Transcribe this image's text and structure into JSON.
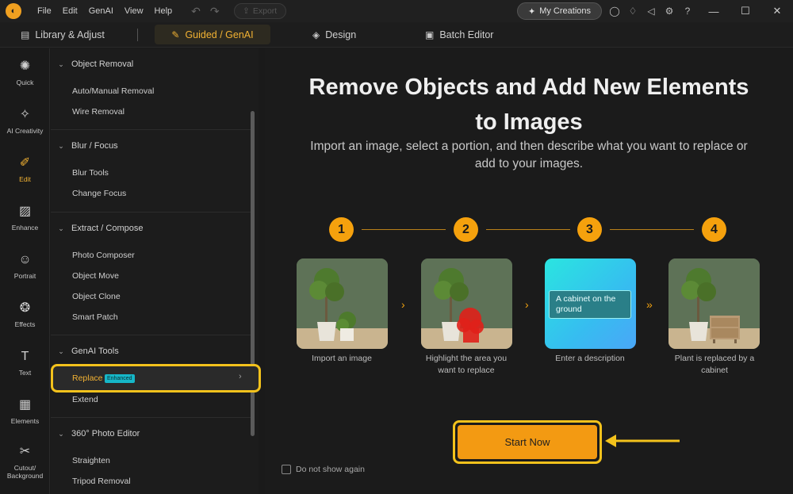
{
  "titlebar": {
    "menu": [
      "File",
      "Edit",
      "GenAI",
      "View",
      "Help"
    ],
    "export_label": "Export",
    "my_creations_label": "My Creations"
  },
  "tabs": [
    {
      "label": "Library & Adjust",
      "icon": "library-icon"
    },
    {
      "label": "Guided / GenAI",
      "icon": "magic-wand-icon",
      "active": true
    },
    {
      "label": "Design",
      "icon": "layers-icon"
    },
    {
      "label": "Batch Editor",
      "icon": "batch-icon"
    }
  ],
  "rail": [
    {
      "label": "Quick",
      "icon": "quick-icon"
    },
    {
      "label": "AI Creativity",
      "icon": "ai-creativity-icon"
    },
    {
      "label": "Edit",
      "icon": "edit-icon",
      "active": true
    },
    {
      "label": "Enhance",
      "icon": "enhance-icon"
    },
    {
      "label": "Portrait",
      "icon": "portrait-icon"
    },
    {
      "label": "Effects",
      "icon": "effects-icon"
    },
    {
      "label": "Text",
      "icon": "text-icon"
    },
    {
      "label": "Elements",
      "icon": "elements-icon"
    },
    {
      "label": "Cutout/ Background",
      "icon": "cutout-icon"
    }
  ],
  "panel": {
    "sections": [
      {
        "title": "Object Removal",
        "items": [
          "Auto/Manual Removal",
          "Wire Removal"
        ]
      },
      {
        "title": "Blur / Focus",
        "items": [
          "Blur Tools",
          "Change Focus"
        ]
      },
      {
        "title": "Extract / Compose",
        "items": [
          "Photo Composer",
          "Object Move",
          "Object Clone",
          "Smart Patch"
        ]
      },
      {
        "title": "GenAI Tools",
        "items": [
          "Replace",
          "Extend"
        ]
      },
      {
        "title": "360° Photo Editor",
        "items": [
          "Straighten",
          "Tripod Removal"
        ]
      }
    ],
    "replace_badge": "Enhanced"
  },
  "main": {
    "title_line1": "Remove Objects and Add New Elements",
    "title_line2": "to Images",
    "subtitle_line1": "Import an image, select a portion, and then describe what you want to replace or",
    "subtitle_line2": "add to your images.",
    "steps": [
      {
        "number": "1",
        "caption": "Import an image"
      },
      {
        "number": "2",
        "caption": "Highlight the area you want to replace"
      },
      {
        "number": "3",
        "caption": "Enter a description"
      },
      {
        "number": "4",
        "caption": "Plant is replaced by a cabinet"
      }
    ],
    "description_example": "A cabinet on the ground",
    "start_label": "Start Now",
    "dont_show_label": "Do not show again"
  },
  "colors": {
    "accent": "#f5a10d",
    "highlight": "#f3c21c",
    "badge": "#16b7c8"
  }
}
